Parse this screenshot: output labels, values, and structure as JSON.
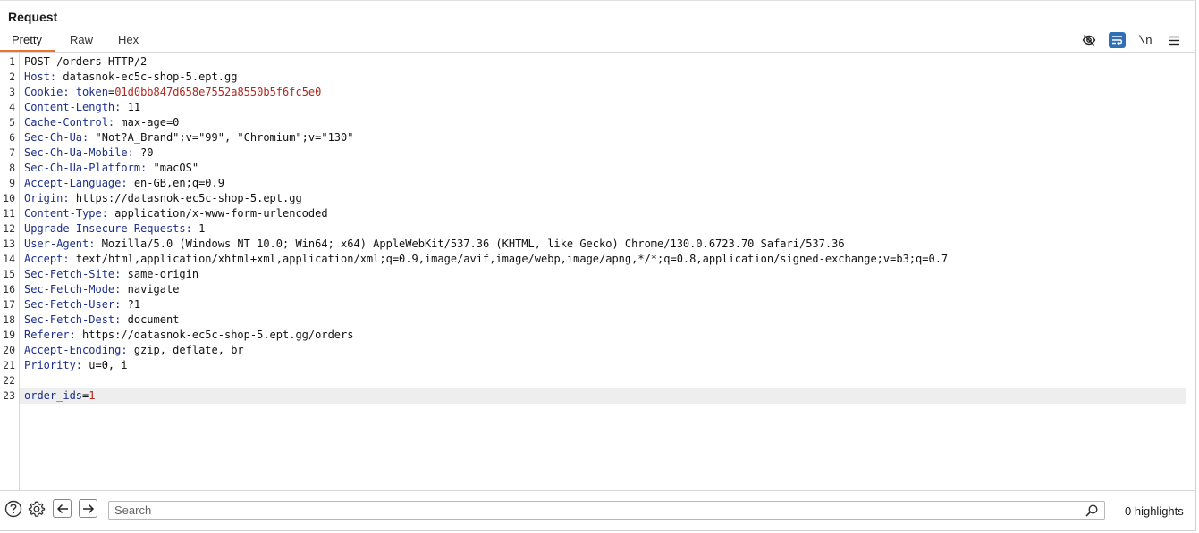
{
  "panel": {
    "title": "Request"
  },
  "tabs": [
    {
      "label": "Pretty",
      "active": true
    },
    {
      "label": "Raw",
      "active": false
    },
    {
      "label": "Hex",
      "active": false
    }
  ],
  "toolbar": {
    "icons": [
      "eye-hidden-icon",
      "word-wrap-icon",
      "newline-toggle",
      "menu-icon"
    ],
    "newline_label": "\\n",
    "accent": "#2f6fb6"
  },
  "colors": {
    "header_key": "#1d2f8c",
    "cookie_value": "#b3261e",
    "active_tab": "#e8742f"
  },
  "request_lines": [
    {
      "num": "1",
      "plain": "POST /orders HTTP/2"
    },
    {
      "num": "2",
      "key": "Host",
      "value": " datasnok-ec5c-shop-5.ept.gg"
    },
    {
      "num": "3",
      "key": "Cookie",
      "value": " ",
      "ckey": "token",
      "cval": "01d0bb847d658e7552a8550b5f6fc5e0"
    },
    {
      "num": "4",
      "key": "Content-Length",
      "value": " 11"
    },
    {
      "num": "5",
      "key": "Cache-Control",
      "value": " max-age=0"
    },
    {
      "num": "6",
      "key": "Sec-Ch-Ua",
      "value": " \"Not?A_Brand\";v=\"99\", \"Chromium\";v=\"130\""
    },
    {
      "num": "7",
      "key": "Sec-Ch-Ua-Mobile",
      "value": " ?0"
    },
    {
      "num": "8",
      "key": "Sec-Ch-Ua-Platform",
      "value": " \"macOS\""
    },
    {
      "num": "9",
      "key": "Accept-Language",
      "value": " en-GB,en;q=0.9"
    },
    {
      "num": "10",
      "key": "Origin",
      "value": " https://datasnok-ec5c-shop-5.ept.gg"
    },
    {
      "num": "11",
      "key": "Content-Type",
      "value": " application/x-www-form-urlencoded"
    },
    {
      "num": "12",
      "key": "Upgrade-Insecure-Requests",
      "value": " 1"
    },
    {
      "num": "13",
      "key": "User-Agent",
      "value": " Mozilla/5.0 (Windows NT 10.0; Win64; x64) AppleWebKit/537.36 (KHTML, like Gecko) Chrome/130.0.6723.70 Safari/537.36"
    },
    {
      "num": "14",
      "key": "Accept",
      "value": " text/html,application/xhtml+xml,application/xml;q=0.9,image/avif,image/webp,image/apng,*/*;q=0.8,application/signed-exchange;v=b3;q=0.7"
    },
    {
      "num": "15",
      "key": "Sec-Fetch-Site",
      "value": " same-origin"
    },
    {
      "num": "16",
      "key": "Sec-Fetch-Mode",
      "value": " navigate"
    },
    {
      "num": "17",
      "key": "Sec-Fetch-User",
      "value": " ?1"
    },
    {
      "num": "18",
      "key": "Sec-Fetch-Dest",
      "value": " document"
    },
    {
      "num": "19",
      "key": "Referer",
      "value": " https://datasnok-ec5c-shop-5.ept.gg/orders"
    },
    {
      "num": "20",
      "key": "Accept-Encoding",
      "value": " gzip, deflate, br"
    },
    {
      "num": "21",
      "key": "Priority",
      "value": " u=0, i"
    },
    {
      "num": "22",
      "plain": ""
    },
    {
      "num": "23",
      "pkey": "order_ids",
      "pval": "1",
      "current": true
    }
  ],
  "bottom": {
    "icons": [
      "help-icon",
      "settings-icon",
      "back-arrow-icon",
      "forward-arrow-icon"
    ],
    "search_placeholder": "Search",
    "highlights": "0 highlights"
  }
}
